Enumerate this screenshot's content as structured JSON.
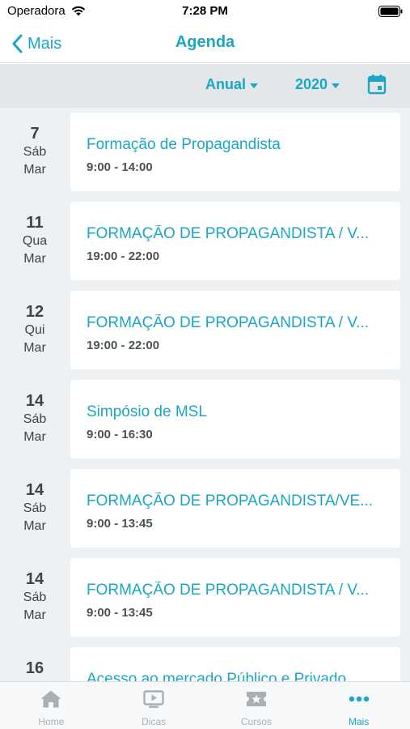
{
  "status_bar": {
    "carrier": "Operadora",
    "time": "7:28 PM"
  },
  "nav": {
    "back_label": "Mais",
    "title": "Agenda"
  },
  "filters": {
    "period": "Anual",
    "year": "2020"
  },
  "events": [
    {
      "day": "7",
      "weekday": "Sáb",
      "month": "Mar",
      "title": "Formação de Propagandista",
      "time": "9:00 - 14:00"
    },
    {
      "day": "11",
      "weekday": "Qua",
      "month": "Mar",
      "title": "FORMAÇÃO DE PROPAGANDISTA / V...",
      "time": "19:00 - 22:00"
    },
    {
      "day": "12",
      "weekday": "Qui",
      "month": "Mar",
      "title": "FORMAÇÃO DE PROPAGANDISTA / V...",
      "time": "19:00 - 22:00"
    },
    {
      "day": "14",
      "weekday": "Sáb",
      "month": "Mar",
      "title": "Simpósio de MSL",
      "time": "9:00 - 16:30"
    },
    {
      "day": "14",
      "weekday": "Sáb",
      "month": "Mar",
      "title": "FORMAÇÃO DE PROPAGANDISTA/VE...",
      "time": "9:00 - 13:45"
    },
    {
      "day": "14",
      "weekday": "Sáb",
      "month": "Mar",
      "title": "FORMAÇÃO DE PROPAGANDISTA / V...",
      "time": "9:00 - 13:45"
    },
    {
      "day": "16",
      "weekday": "",
      "month": "",
      "title": "Acesso ao mercado Público e Privado",
      "time": ""
    }
  ],
  "tabs": [
    {
      "label": "Home",
      "icon": "home-icon",
      "active": false
    },
    {
      "label": "Dicas",
      "icon": "tv-icon",
      "active": false
    },
    {
      "label": "Cursos",
      "icon": "ticket-icon",
      "active": false
    },
    {
      "label": "Mais",
      "icon": "more-icon",
      "active": true
    }
  ],
  "colors": {
    "accent": "#1aa6c4",
    "tab_inactive": "#a8b0b5",
    "list_bg": "#eef1f3",
    "filter_bg": "#e3e7ea"
  }
}
